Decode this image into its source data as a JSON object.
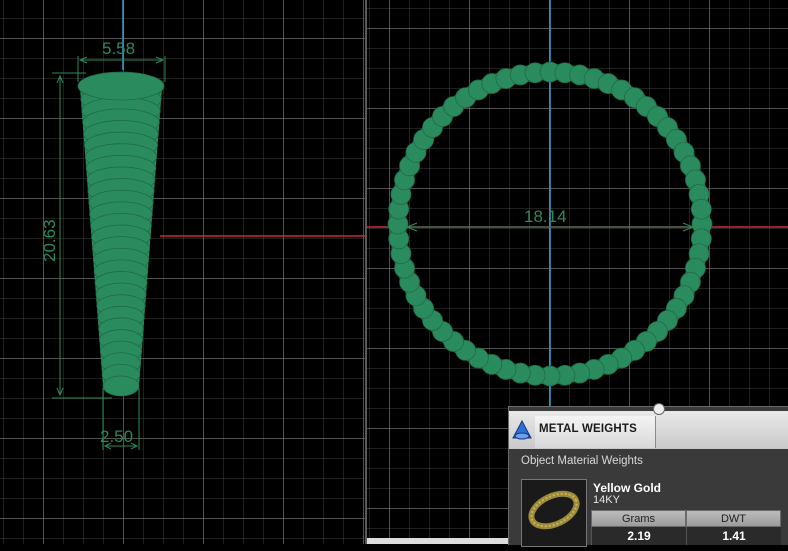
{
  "viewports": {
    "side_view": {
      "dimensions": {
        "top_width": "5.58",
        "height": "20.63",
        "bottom_width": "2.50"
      }
    },
    "front_view": {
      "dimensions": {
        "diameter": "18.14"
      }
    }
  },
  "colors": {
    "model": "#2a8c5e",
    "model_outline": "#1f6b46",
    "dimension": "#2b8a5a",
    "axis_x": "#c0303a",
    "axis_y": "#3aa0c8"
  },
  "metal_weights_panel": {
    "icon": "metal-weights-icon",
    "title": "METAL WEIGHTS",
    "subtitle": "Object Material Weights",
    "material": "Yellow Gold",
    "karat": "14KY",
    "columns": [
      "Grams",
      "DWT"
    ],
    "values": [
      "2.19",
      "1.41"
    ]
  }
}
